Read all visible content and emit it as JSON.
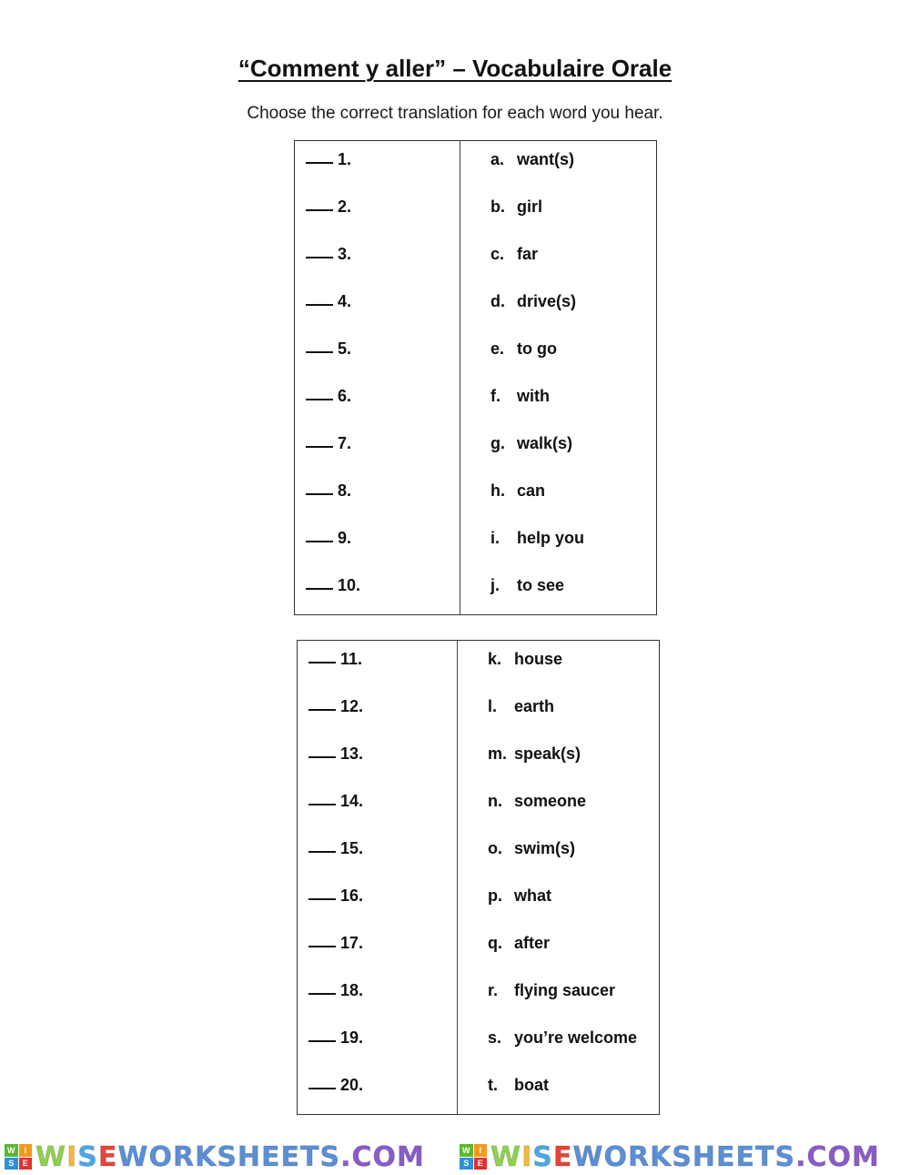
{
  "document": {
    "title": "“Comment y aller” – Vocabulaire Orale",
    "instructions": "Choose the correct translation for each word you hear."
  },
  "tables": [
    {
      "questions": [
        "1.",
        "2.",
        "3.",
        "4.",
        "5.",
        "6.",
        "7.",
        "8.",
        "9.",
        "10."
      ],
      "answers": [
        {
          "letter": "a.",
          "text": "want(s)"
        },
        {
          "letter": "b.",
          "text": "girl"
        },
        {
          "letter": "c.",
          "text": "far"
        },
        {
          "letter": "d.",
          "text": "drive(s)"
        },
        {
          "letter": "e.",
          "text": "to go"
        },
        {
          "letter": "f.",
          "text": "with"
        },
        {
          "letter": "g.",
          "text": "walk(s)"
        },
        {
          "letter": "h.",
          "text": "can"
        },
        {
          "letter": "i.",
          "text": "help you"
        },
        {
          "letter": "j.",
          "text": "to see"
        }
      ]
    },
    {
      "questions": [
        "11.",
        "12.",
        "13.",
        "14.",
        "15.",
        "16.",
        "17.",
        "18.",
        "19.",
        "20."
      ],
      "answers": [
        {
          "letter": "k.",
          "text": "house"
        },
        {
          "letter": "l.",
          "text": "earth"
        },
        {
          "letter": "m.",
          "text": "speak(s)"
        },
        {
          "letter": "n.",
          "text": "someone"
        },
        {
          "letter": "o.",
          "text": "swim(s)"
        },
        {
          "letter": "p.",
          "text": "what"
        },
        {
          "letter": "q.",
          "text": "after"
        },
        {
          "letter": "r.",
          "text": "flying saucer"
        },
        {
          "letter": "s.",
          "text": "you’re welcome"
        },
        {
          "letter": "t.",
          "text": "boat"
        }
      ]
    }
  ],
  "footer": {
    "logo_box_letters": [
      "W",
      "I",
      "S",
      "E"
    ],
    "logo_box_colors": [
      "#5bb82e",
      "#f39a1e",
      "#2f8fd8",
      "#e0312f"
    ],
    "logo_segments": [
      {
        "text": "W",
        "color": "#8fd14f"
      },
      {
        "text": "I",
        "color": "#f6b73c"
      },
      {
        "text": "S",
        "color": "#4aa8e8"
      },
      {
        "text": "E",
        "color": "#e8443a"
      },
      {
        "text": "WORKSHEETS",
        "color": "#5b8fd6"
      },
      {
        "text": ".COM",
        "color": "#8a5cc8"
      }
    ]
  }
}
